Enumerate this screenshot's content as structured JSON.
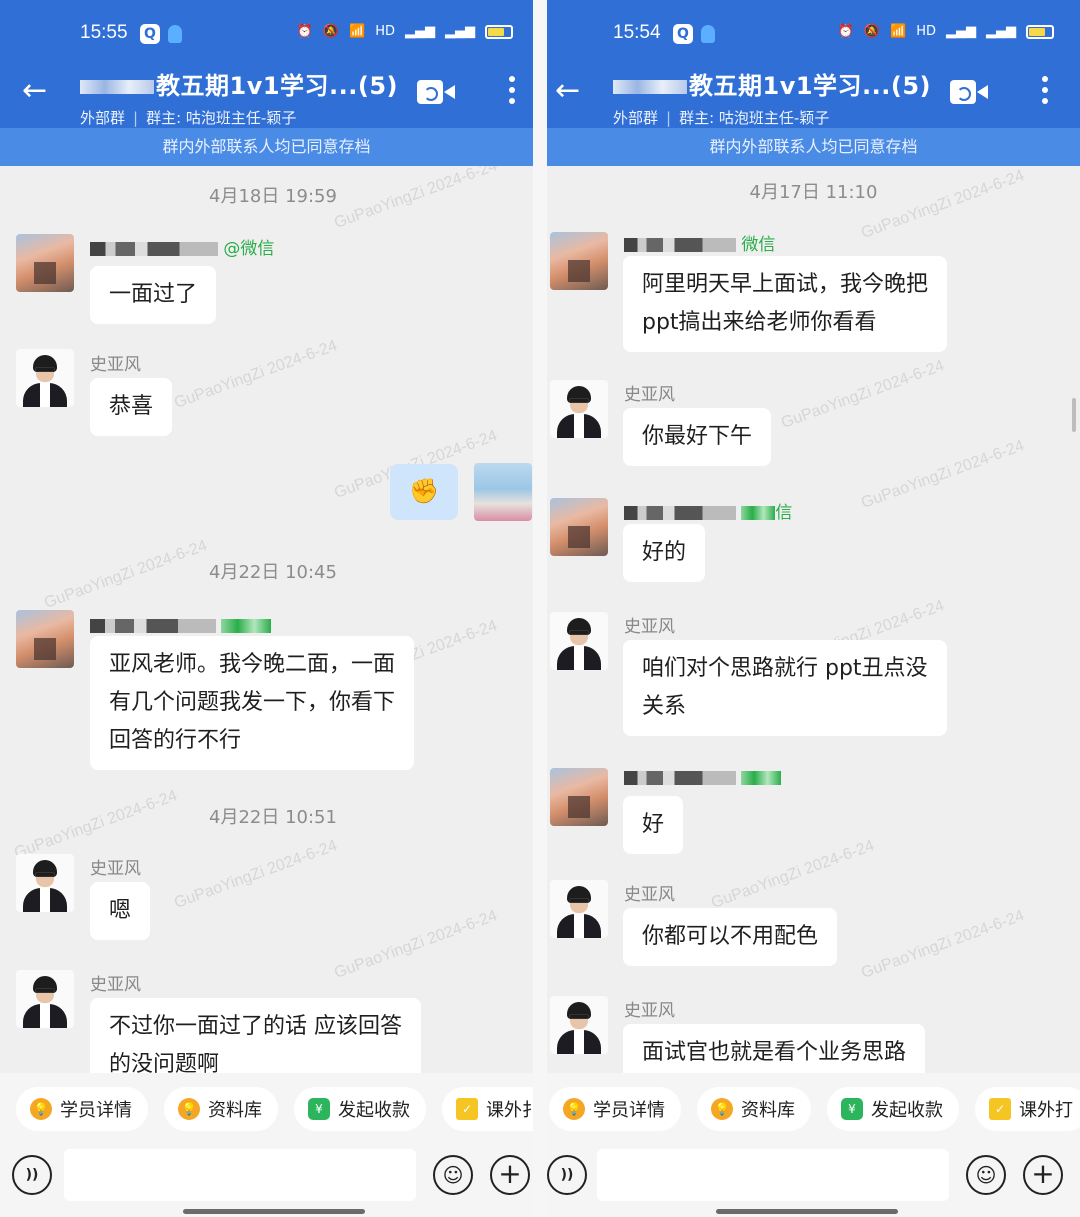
{
  "left": {
    "status_time": "15:55",
    "title": "教五期1v1学习...(5)",
    "subtitle_type": "外部群",
    "subtitle_owner": "群主: 咕泡班主任-颖子",
    "notice": "群内外部联系人均已同意存档",
    "dates": [
      "4月18日  19:59",
      "4月22日  10:45",
      "4月22日  10:51"
    ],
    "student_source": "@微信",
    "teacher_name": "史亚风",
    "messages": [
      "一面过了",
      "恭喜",
      "✊",
      "亚风老师。我今晚二面，一面\n有几个问题我发一下，你看下\n回答的行不行",
      "嗯",
      "不过你一面过了的话 应该回答\n的没问题啊"
    ]
  },
  "right": {
    "status_time": "15:54",
    "title": "教五期1v1学习...(5)",
    "subtitle_type": "外部群",
    "subtitle_owner": "群主: 咕泡班主任-颖子",
    "notice": "群内外部联系人均已同意存档",
    "dates": [
      "4月17日  11:10"
    ],
    "student_source_1": "微信",
    "student_source_2": "信",
    "teacher_name": "史亚风",
    "messages": [
      "阿里明天早上面试，我今晚把\nppt搞出来给老师你看看",
      "你最好下午",
      "好的",
      "咱们对个思路就行 ppt丑点没\n关系",
      "好",
      "你都可以不用配色",
      "面试官也就是看个业务思路"
    ]
  },
  "watermark": "GuPaoYingZi 2024-6-24",
  "quick_actions": [
    "学员详情",
    "资料库",
    "发起收款",
    "课外打"
  ],
  "quick_actions_left_cut": "课外扌",
  "icons": {
    "back": "back-arrow-icon",
    "video": "video-call-icon",
    "more": "more-vertical-icon",
    "voice": "voice-icon",
    "emoji": "emoji-icon",
    "plus": "plus-icon"
  },
  "colors": {
    "header_blue": "#2f6fd6",
    "notice_blue": "#4a8be6",
    "self_bubble": "#cfe5fb",
    "wechat_green": "#2aad4a"
  }
}
